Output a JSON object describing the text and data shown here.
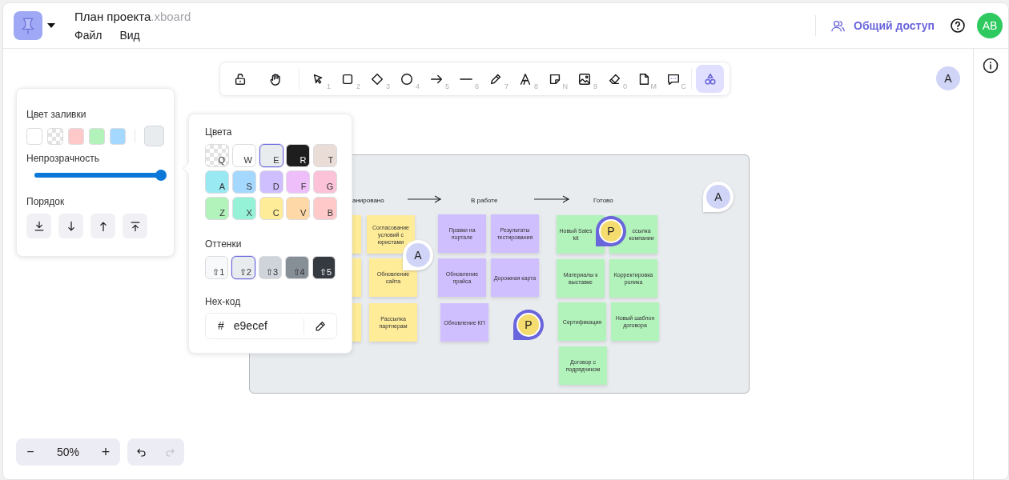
{
  "header": {
    "title": "План проекта",
    "extension": ".xboard",
    "menu": [
      "Файл",
      "Вид"
    ],
    "share_label": "Общий доступ",
    "user_initials": "AB"
  },
  "toolbar": [
    {
      "kind": "lock",
      "selected": false
    },
    {
      "kind": "hand",
      "selected": false
    },
    {
      "kind": "select",
      "key": "1",
      "selected": false
    },
    {
      "kind": "rectangle",
      "key": "2",
      "selected": false
    },
    {
      "kind": "diamond",
      "key": "3",
      "selected": false
    },
    {
      "kind": "ellipse",
      "key": "4",
      "selected": false
    },
    {
      "kind": "arrow",
      "key": "5",
      "selected": false
    },
    {
      "kind": "line",
      "key": "6",
      "selected": false
    },
    {
      "kind": "pencil",
      "key": "7",
      "selected": false
    },
    {
      "kind": "text",
      "key": "8",
      "selected": false
    },
    {
      "kind": "note",
      "key": "N",
      "selected": false
    },
    {
      "kind": "image",
      "key": "9",
      "selected": false
    },
    {
      "kind": "eraser",
      "key": "0",
      "selected": false
    },
    {
      "kind": "document",
      "key": "M",
      "selected": false
    },
    {
      "kind": "comment",
      "key": "C",
      "selected": false
    },
    {
      "kind": "shapes",
      "selected": true
    }
  ],
  "viewer_initial": "A",
  "fill_panel": {
    "fill_label": "Цвет заливки",
    "fill_swatches": [
      {
        "color": "#ffffff",
        "selected": false
      },
      {
        "kind": "transparent",
        "selected": false
      },
      {
        "color": "#ffc9c9",
        "selected": false
      },
      {
        "color": "#b2f2bb",
        "selected": false
      },
      {
        "color": "#a5d8ff",
        "selected": false
      }
    ],
    "current_fill": {
      "color": "#e9ecef"
    },
    "opacity_label": "Непрозрачность",
    "opacity": {
      "level": 1
    },
    "order_label": "Порядок",
    "order_buttons": [
      {
        "kind": "to-back"
      },
      {
        "kind": "backward"
      },
      {
        "kind": "forward"
      },
      {
        "kind": "to-front"
      }
    ]
  },
  "color_picker": {
    "colors_label": "Цвета",
    "colors": [
      {
        "key": "Q",
        "kind": "transparent",
        "selected": false
      },
      {
        "key": "W",
        "color": "#ffffff",
        "selected": false
      },
      {
        "key": "E",
        "color": "#e9ecef",
        "selected": true
      },
      {
        "key": "R",
        "color": "#1e1e1e",
        "selected": false
      },
      {
        "key": "T",
        "color": "#eaddd7",
        "selected": false
      },
      {
        "key": "A",
        "color": "#99e9f2",
        "selected": false
      },
      {
        "key": "S",
        "color": "#a5d8ff",
        "selected": false
      },
      {
        "key": "D",
        "color": "#d0bfff",
        "selected": false
      },
      {
        "key": "F",
        "color": "#eebefa",
        "selected": false
      },
      {
        "key": "G",
        "color": "#fcc2d7",
        "selected": false
      },
      {
        "key": "Z",
        "color": "#b2f2bb",
        "selected": false
      },
      {
        "key": "X",
        "color": "#96f2d7",
        "selected": false
      },
      {
        "key": "C",
        "color": "#ffec99",
        "selected": false
      },
      {
        "key": "V",
        "color": "#ffd8a8",
        "selected": false
      },
      {
        "key": "B",
        "color": "#ffc9c9",
        "selected": false
      }
    ],
    "shades_label": "Оттенки",
    "shades": [
      {
        "key": "⇧1",
        "color": "#f8f9fa",
        "selected": false
      },
      {
        "key": "⇧2",
        "color": "#e9ecef",
        "selected": true
      },
      {
        "key": "⇧3",
        "color": "#ced4da",
        "selected": false
      },
      {
        "key": "⇧4",
        "color": "#868e96",
        "selected": false
      },
      {
        "key": "⇧5",
        "color": "#343a40",
        "selected": false
      }
    ],
    "hex_label": "Hex-код",
    "hex_prefix": "#",
    "hex_value": "e9ecef"
  },
  "board": {
    "columns": [
      "анировано",
      "В работе",
      "Готово"
    ],
    "notes": [
      {
        "color": "#ffec99"
      },
      {
        "color": "#ffec99"
      },
      {
        "color": "#ffec99"
      },
      {
        "text": "Согласование условий с юристами",
        "color": "#ffec99"
      },
      {
        "text": "Обновление сайта",
        "color": "#ffec99"
      },
      {
        "text": "Рассылка партнерам",
        "color": "#ffec99"
      },
      {
        "text": "Правки на портале",
        "color": "#d0bfff"
      },
      {
        "text": "Результаты тестирования",
        "color": "#d0bfff"
      },
      {
        "text": "Обновление прайса",
        "color": "#d0bfff"
      },
      {
        "text": "Дорожная карта",
        "color": "#d0bfff"
      },
      {
        "text": "Обновление КП",
        "color": "#d0bfff"
      },
      {
        "text": "Новый Sales kit",
        "color": "#b2f2bb"
      },
      {
        "text": "ссылка компании",
        "color": "#b2f2bb"
      },
      {
        "text": "Материалы к выставке",
        "color": "#b2f2bb"
      },
      {
        "text": "Корректировка ролика",
        "color": "#b2f2bb"
      },
      {
        "text": "Сертификация",
        "color": "#b2f2bb"
      },
      {
        "text": "Новый шаблон договора",
        "color": "#b2f2bb"
      },
      {
        "text": "Договор с подрядчиком",
        "color": "#b2f2bb"
      }
    ],
    "cursors": [
      {
        "label": "A",
        "color": "#d0d4f7"
      },
      {
        "label": "P",
        "color": "#f5dc6e"
      },
      {
        "label": "P",
        "color": "#f5dc6e"
      },
      {
        "label": "A",
        "color": "#d0d4f7"
      }
    ]
  },
  "zoom": {
    "level_text": "50%",
    "minus": "−",
    "plus": "+"
  },
  "history": {
    "undo_disabled": false,
    "redo_disabled": true
  }
}
